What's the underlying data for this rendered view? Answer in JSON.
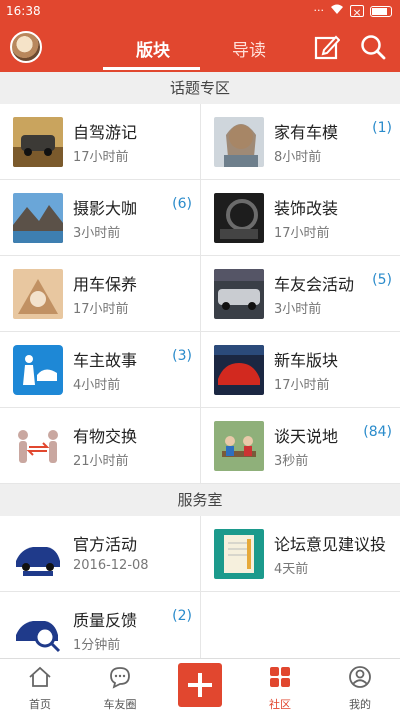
{
  "status_bar": {
    "time": "16:38"
  },
  "header": {
    "tabs": [
      {
        "label": "版块",
        "active": true
      },
      {
        "label": "导读",
        "active": false
      }
    ],
    "icons": [
      "avatar",
      "edit-icon",
      "search-icon"
    ]
  },
  "sections": [
    {
      "title": "话题专区",
      "items": [
        {
          "title": "自驾游记",
          "time": "17小时前",
          "count": "",
          "icon": "car-trip-thumb"
        },
        {
          "title": "家有车模",
          "time": "8小时前",
          "count": "(1)",
          "icon": "model-girl-thumb"
        },
        {
          "title": "摄影大咖",
          "time": "3小时前",
          "count": "(6)",
          "icon": "mountain-photo-thumb"
        },
        {
          "title": "装饰改装",
          "time": "17小时前",
          "count": "",
          "icon": "car-interior-thumb"
        },
        {
          "title": "用车保养",
          "time": "17小时前",
          "count": "",
          "icon": "maintenance-thumb"
        },
        {
          "title": "车友会活动",
          "time": "3小时前",
          "count": "(5)",
          "icon": "club-event-thumb"
        },
        {
          "title": "车主故事",
          "time": "4小时前",
          "count": "(3)",
          "icon": "owner-story-thumb"
        },
        {
          "title": "新车版块",
          "time": "17小时前",
          "count": "",
          "icon": "new-car-thumb"
        },
        {
          "title": "有物交换",
          "time": "21小时前",
          "count": "",
          "icon": "exchange-thumb"
        },
        {
          "title": "谈天说地",
          "time": "3秒前",
          "count": "(84)",
          "icon": "chat-thumb"
        }
      ]
    },
    {
      "title": "服务室",
      "items": [
        {
          "title": "官方活动",
          "time": "2016-12-08",
          "count": "",
          "icon": "official-car-thumb"
        },
        {
          "title": "论坛意见建议投",
          "time": "4天前",
          "count": "",
          "icon": "notebook-thumb"
        },
        {
          "title": "质量反馈",
          "time": "1分钟前",
          "count": "(2)",
          "icon": "quality-thumb"
        }
      ]
    }
  ],
  "bottom_nav": [
    {
      "label": "首页",
      "icon": "home-icon",
      "active": false
    },
    {
      "label": "车友圈",
      "icon": "chat-bubble-icon",
      "active": false
    },
    {
      "label": "",
      "icon": "plus-icon",
      "active": false
    },
    {
      "label": "社区",
      "icon": "community-icon",
      "active": true
    },
    {
      "label": "我的",
      "icon": "profile-icon",
      "active": false
    }
  ],
  "colors": {
    "brand": "#e1472f",
    "count": "#2a8bcb"
  }
}
